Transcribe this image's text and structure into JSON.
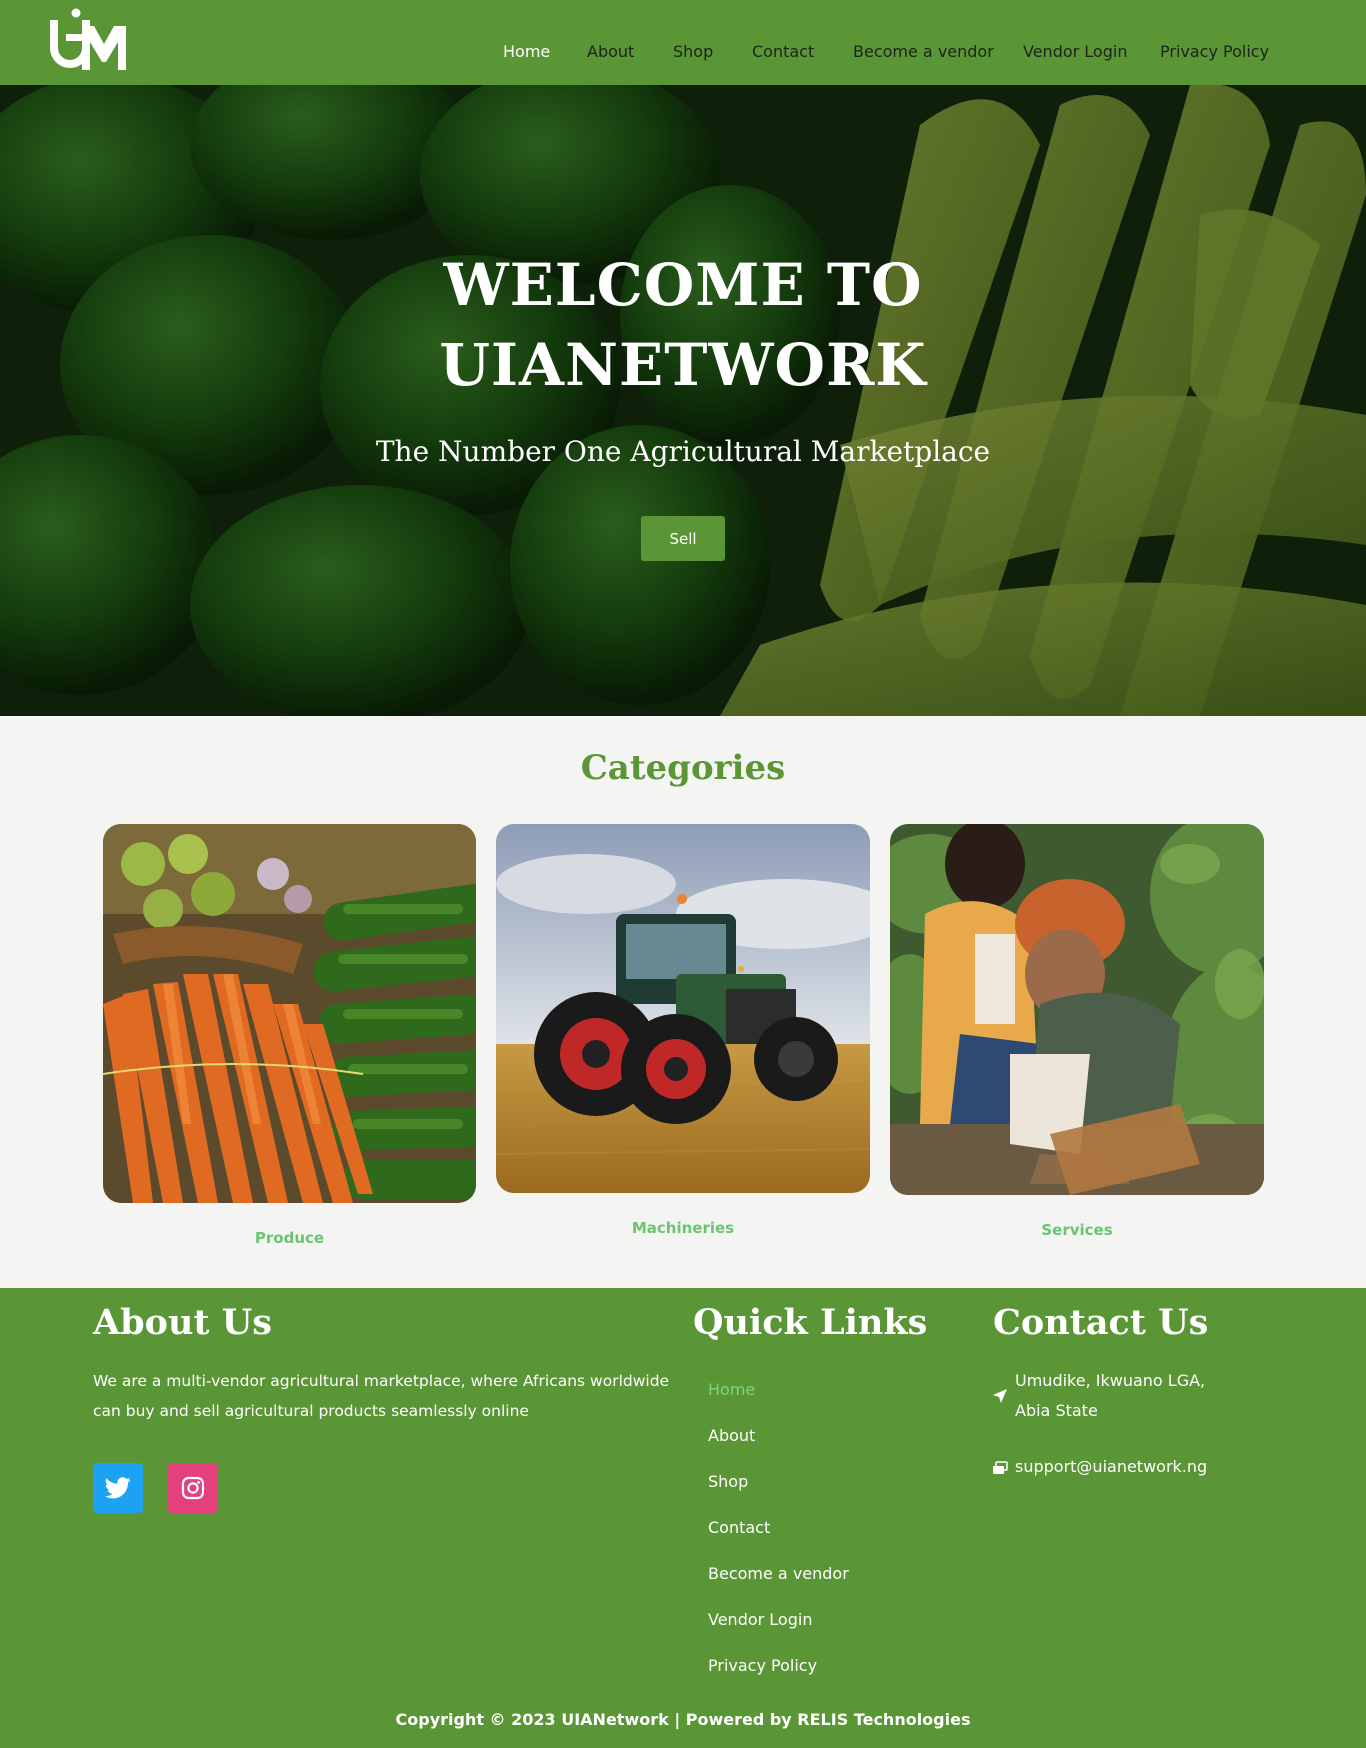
{
  "brand": {
    "logo_text": "UIANetwork"
  },
  "nav": {
    "items": [
      {
        "label": "Home",
        "active": true
      },
      {
        "label": "About",
        "active": false
      },
      {
        "label": "Shop",
        "active": false
      },
      {
        "label": "Contact",
        "active": false
      },
      {
        "label": "Become a vendor",
        "active": false
      },
      {
        "label": "Vendor Login",
        "active": false
      },
      {
        "label": "Privacy Policy",
        "active": false
      }
    ]
  },
  "hero": {
    "title_line1": "WELCOME TO",
    "title_line2": "UIANETWORK",
    "subtitle": "The Number One Agricultural Marketplace",
    "cta_label": "Sell"
  },
  "categories": {
    "title": "Categories",
    "items": [
      {
        "label": "Produce",
        "image": "vegetables-stall-image"
      },
      {
        "label": "Machineries",
        "image": "tractor-image"
      },
      {
        "label": "Services",
        "image": "farmers-planting-image"
      }
    ]
  },
  "footer": {
    "about": {
      "heading": "About Us",
      "text": "We are a multi-vendor agricultural marketplace, where Africans worldwide can buy and sell agricultural products seamlessly online"
    },
    "social": [
      {
        "name": "twitter-icon",
        "color": "#1da1f2"
      },
      {
        "name": "instagram-icon",
        "color": "#e4407b"
      }
    ],
    "quick_links": {
      "heading": "Quick Links",
      "items": [
        "Home",
        "About",
        "Shop",
        "Contact",
        "Become a vendor",
        "Vendor Login",
        "Privacy Policy"
      ]
    },
    "contact": {
      "heading": "Contact Us",
      "address": "Umudike, Ikwuano LGA, Abia State",
      "email": "support@uianetwork.ng"
    },
    "copyright": "Copyright © 2023 UIANetwork | Powered by RELIS Technologies"
  },
  "colors": {
    "brand_green": "#5a9636",
    "link_active": "#7ed383",
    "category_label": "#6cc472"
  }
}
